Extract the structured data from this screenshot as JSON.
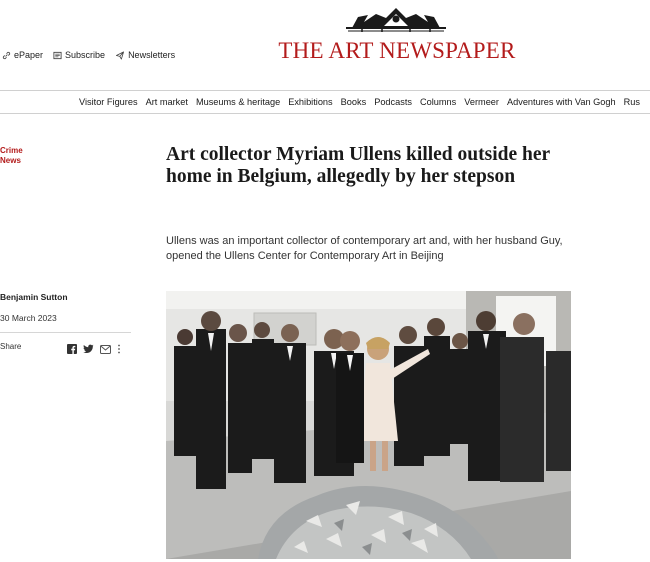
{
  "header": {
    "utilities": [
      {
        "label": "ePaper",
        "icon": "link-icon"
      },
      {
        "label": "Subscribe",
        "icon": "newspaper-icon"
      },
      {
        "label": "Newsletters",
        "icon": "paper-plane-icon"
      }
    ],
    "brand": "THE ART NEWSPAPER",
    "brand_color": "#b31b1b"
  },
  "nav": {
    "items": [
      "Visitor Figures",
      "Art market",
      "Museums & heritage",
      "Exhibitions",
      "Books",
      "Podcasts",
      "Columns",
      "Vermeer",
      "Adventures with Van Gogh",
      "Rus"
    ]
  },
  "article": {
    "category_line1": "Crime",
    "category_line2": "News",
    "headline": "Art collector Myriam Ullens killed outside her home in Belgium, allegedly by her stepson",
    "standfirst": "Ullens was an important collector of contemporary art and, with her husband Guy, opened the Ullens Center for Contemporary Art in Beijing",
    "author": "Benjamin Sutton",
    "date": "30 March 2023",
    "share_label": "Share",
    "share_icons": [
      "facebook-icon",
      "twitter-icon",
      "email-icon",
      "more-icon"
    ]
  }
}
